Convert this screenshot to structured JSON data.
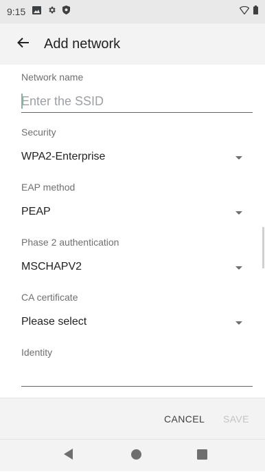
{
  "status_bar": {
    "time": "9:15",
    "icons": [
      "image-icon",
      "gear-icon",
      "shield-icon"
    ],
    "right_icons": [
      "wifi-icon",
      "battery-icon"
    ]
  },
  "app_bar": {
    "title": "Add network",
    "back_icon": "arrow-back-icon"
  },
  "form": {
    "network_name": {
      "label": "Network name",
      "placeholder": "Enter the SSID",
      "value": ""
    },
    "security": {
      "label": "Security",
      "value": "WPA2-Enterprise"
    },
    "eap_method": {
      "label": "EAP method",
      "value": "PEAP"
    },
    "phase2": {
      "label": "Phase 2 authentication",
      "value": "MSCHAPV2"
    },
    "ca_certificate": {
      "label": "CA certificate",
      "value": "Please select"
    },
    "identity": {
      "label": "Identity",
      "value": ""
    }
  },
  "buttons": {
    "cancel": "CANCEL",
    "save": "SAVE"
  },
  "nav": [
    "back-icon",
    "home-icon",
    "recents-icon"
  ],
  "colors": {
    "accent": "#8ab4a0",
    "disabled": "#c4c4c4",
    "bar_bg": "#f3f3f3"
  }
}
